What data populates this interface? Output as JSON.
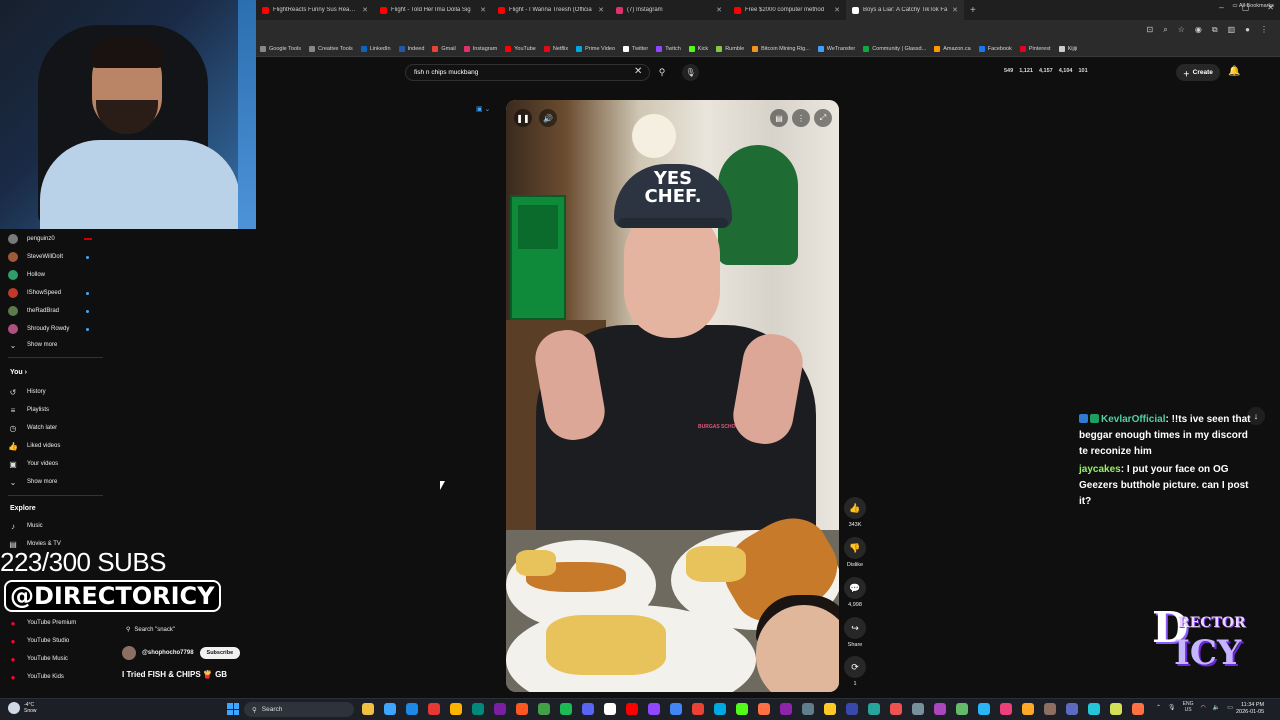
{
  "browser": {
    "tabs": [
      {
        "label": "FlightReacts Funny Sus Reactio",
        "color": "#ff0000"
      },
      {
        "label": "Flight - Told Her Ima Dolla Sig",
        "color": "#ff0000"
      },
      {
        "label": "Flight - I Wanna Treesh (Officia",
        "color": "#ff0000"
      },
      {
        "label": "(7) Instagram",
        "color": "#e1306c"
      },
      {
        "label": "Free $2000 computer method",
        "color": "#ff0000"
      },
      {
        "label": "Boys a Liar: A Catchy TikTok Fa",
        "color": "#ffffff"
      }
    ],
    "new_tab": "+",
    "window_controls": [
      "–",
      "▢",
      "✕"
    ],
    "bookmarks": [
      {
        "label": "Google Tools",
        "color": "#888888"
      },
      {
        "label": "Creative Tools",
        "color": "#888888"
      },
      {
        "label": "LinkedIn",
        "color": "#0a66c2"
      },
      {
        "label": "Indeed",
        "color": "#2557a7"
      },
      {
        "label": "Gmail",
        "color": "#ea4335"
      },
      {
        "label": "Instagram",
        "color": "#e1306c"
      },
      {
        "label": "YouTube",
        "color": "#ff0000"
      },
      {
        "label": "Netflix",
        "color": "#e50914"
      },
      {
        "label": "Prime Video",
        "color": "#00a8e1"
      },
      {
        "label": "Twitter",
        "color": "#ffffff"
      },
      {
        "label": "Twitch",
        "color": "#9146ff"
      },
      {
        "label": "Kick",
        "color": "#53fc18"
      },
      {
        "label": "Rumble",
        "color": "#85c742"
      },
      {
        "label": "Bitcoin Mining Rig...",
        "color": "#f7931a"
      },
      {
        "label": "WeTransfer",
        "color": "#409fff"
      },
      {
        "label": "Community | Glassd...",
        "color": "#0caa41"
      },
      {
        "label": "Amazon.ca",
        "color": "#ff9900"
      },
      {
        "label": "Facebook",
        "color": "#1877f2"
      },
      {
        "label": "Pinterest",
        "color": "#e60023"
      },
      {
        "label": "Kijiji",
        "color": "#cccccc"
      }
    ],
    "all_bookmarks": "All Bookmarks"
  },
  "youtube": {
    "search_query": "fish n chips muckbang",
    "stats": [
      "549",
      "1,121",
      "4,157",
      "4,104",
      "101"
    ],
    "create_label": "Create"
  },
  "sidebar": {
    "subscriptions": [
      {
        "name": "penguinz0",
        "color": "#7a7a7a",
        "live": true
      },
      {
        "name": "SteveWillDoIt",
        "color": "#a05a3a",
        "dot": true
      },
      {
        "name": "Hollow",
        "color": "#2f9e6a"
      },
      {
        "name": "IShowSpeed",
        "color": "#c0392b",
        "dot": true
      },
      {
        "name": "theRadBrad",
        "color": "#5d7a4c",
        "dot": true
      },
      {
        "name": "Shroudy Rowdy",
        "color": "#b05080",
        "dot": true
      }
    ],
    "show_more": "Show more",
    "you_heading": "You",
    "you_items": [
      {
        "label": "History",
        "icon": "history-icon"
      },
      {
        "label": "Playlists",
        "icon": "playlists-icon"
      },
      {
        "label": "Watch later",
        "icon": "watch-later-icon"
      },
      {
        "label": "Liked videos",
        "icon": "liked-videos-icon"
      },
      {
        "label": "Your videos",
        "icon": "your-videos-icon"
      }
    ],
    "show_more_2": "Show more",
    "explore_heading": "Explore",
    "explore_items": [
      {
        "label": "Music",
        "icon": "music-icon"
      },
      {
        "label": "Movies & TV",
        "icon": "movies-icon"
      }
    ],
    "more_from": [
      {
        "label": "YouTube Premium"
      },
      {
        "label": "YouTube Studio"
      },
      {
        "label": "YouTube Music"
      },
      {
        "label": "YouTube Kids"
      }
    ]
  },
  "overlay": {
    "subs_count": "223/300 SUBS",
    "handle": "@DIRECTORICY"
  },
  "short": {
    "search_snack": "Search \"snack\"",
    "channel": "@shophocho7798",
    "subscribe": "Subscribe",
    "title": "I Tried FISH & CHIPS 🍟 GB",
    "cap_text": "YES CHEF.",
    "shirt_text": "BURGAS SCHOOL",
    "actions": [
      {
        "icon": "like-icon",
        "label": "343K",
        "glyph": "👍"
      },
      {
        "icon": "dislike-icon",
        "label": "Dislike",
        "glyph": "👎"
      },
      {
        "icon": "comment-icon",
        "label": "4,998",
        "glyph": "💬"
      },
      {
        "icon": "share-icon",
        "label": "Share",
        "glyph": "↪"
      },
      {
        "icon": "remix-icon",
        "label": "1",
        "glyph": "⟳"
      }
    ]
  },
  "chat": [
    {
      "user": "KevlarOfficial",
      "text": ": !!ts ive seen that beggar enough times in my discord te reconize him"
    },
    {
      "user": "jaycakes",
      "text": ": I put your face on OG Geezers butthole picture. can I post it?"
    }
  ],
  "logo": {
    "d": "D",
    "rector": "RECTOR",
    "icy": "ICY"
  },
  "taskbar": {
    "temp": "-4°C",
    "condition": "Snow",
    "search": "Search",
    "lang": "ENG",
    "region": "US",
    "time": "11:34 PM",
    "date": "2026-01-05",
    "apps": [
      "#f0c040",
      "#3ea6ff",
      "#1e88e5",
      "#e53935",
      "#ffb300",
      "#00897b",
      "#7b1fa2",
      "#ff5722",
      "#43a047",
      "#1db954",
      "#5865f2",
      "#ffffff",
      "#ff0000",
      "#9146ff",
      "#4285f4",
      "#ea4335",
      "#00a8e1",
      "#53fc18",
      "#ff7043",
      "#8e24aa",
      "#607d8b",
      "#ffca28",
      "#3949ab",
      "#26a69a",
      "#ef5350",
      "#78909c",
      "#ab47bc",
      "#66bb6a",
      "#29b6f6",
      "#ec407a",
      "#ffa726",
      "#8d6e63",
      "#5c6bc0",
      "#26c6da",
      "#d4e157",
      "#ff7043",
      "#bdbdbd",
      "#e53935"
    ]
  }
}
